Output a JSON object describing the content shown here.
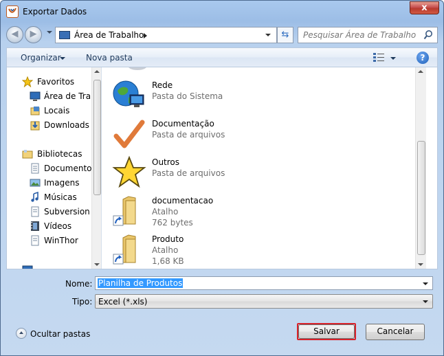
{
  "window": {
    "title": "Exportar Dados",
    "close_glyph": "x"
  },
  "navigation": {
    "back_glyph": "◀",
    "forward_glyph": "▶",
    "address": {
      "location": "Área de Trabalho"
    },
    "refresh_glyph": "⇆",
    "search": {
      "placeholder": "Pesquisar Área de Trabalho"
    }
  },
  "toolbar": {
    "organize": "Organizar",
    "new_folder": "Nova pasta",
    "help_glyph": "?"
  },
  "sidebar": {
    "favorites": {
      "label": "Favoritos",
      "items": [
        {
          "label": "Área de Trabalho",
          "icon": "desktop-icon"
        },
        {
          "label": "Locais",
          "icon": "recent-places-icon"
        },
        {
          "label": "Downloads",
          "icon": "downloads-icon"
        }
      ]
    },
    "libraries": {
      "label": "Bibliotecas",
      "items": [
        {
          "label": "Documentos",
          "icon": "documents-icon"
        },
        {
          "label": "Imagens",
          "icon": "pictures-icon"
        },
        {
          "label": "Músicas",
          "icon": "music-icon"
        },
        {
          "label": "Subversion",
          "icon": "subversion-icon"
        },
        {
          "label": "Vídeos",
          "icon": "videos-icon"
        },
        {
          "label": "WinThor",
          "icon": "winthor-icon"
        }
      ]
    }
  },
  "files": [
    {
      "name": "Rede",
      "type": "Pasta do Sistema",
      "size": "",
      "icon": "network-globe-icon"
    },
    {
      "name": "Documentação",
      "type": "Pasta de arquivos",
      "size": "",
      "icon": "checkmark-folder-icon"
    },
    {
      "name": "Outros",
      "type": "Pasta de arquivos",
      "size": "",
      "icon": "star-folder-icon"
    },
    {
      "name": "documentacao",
      "type": "Atalho",
      "size": "762 bytes",
      "icon": "folder-shortcut-icon"
    },
    {
      "name": "Produto",
      "type": "Atalho",
      "size": "1,68 KB",
      "icon": "folder-shortcut-icon"
    }
  ],
  "form": {
    "name_label": "Nome:",
    "name_value": "Planilha de Produtos",
    "type_label": "Tipo:",
    "type_value": "Excel (*.xls)"
  },
  "footer": {
    "hide_folders": "Ocultar pastas",
    "save": "Salvar",
    "cancel": "Cancelar"
  },
  "colors": {
    "highlight_border": "#d9222a",
    "selection": "#3399ff"
  }
}
